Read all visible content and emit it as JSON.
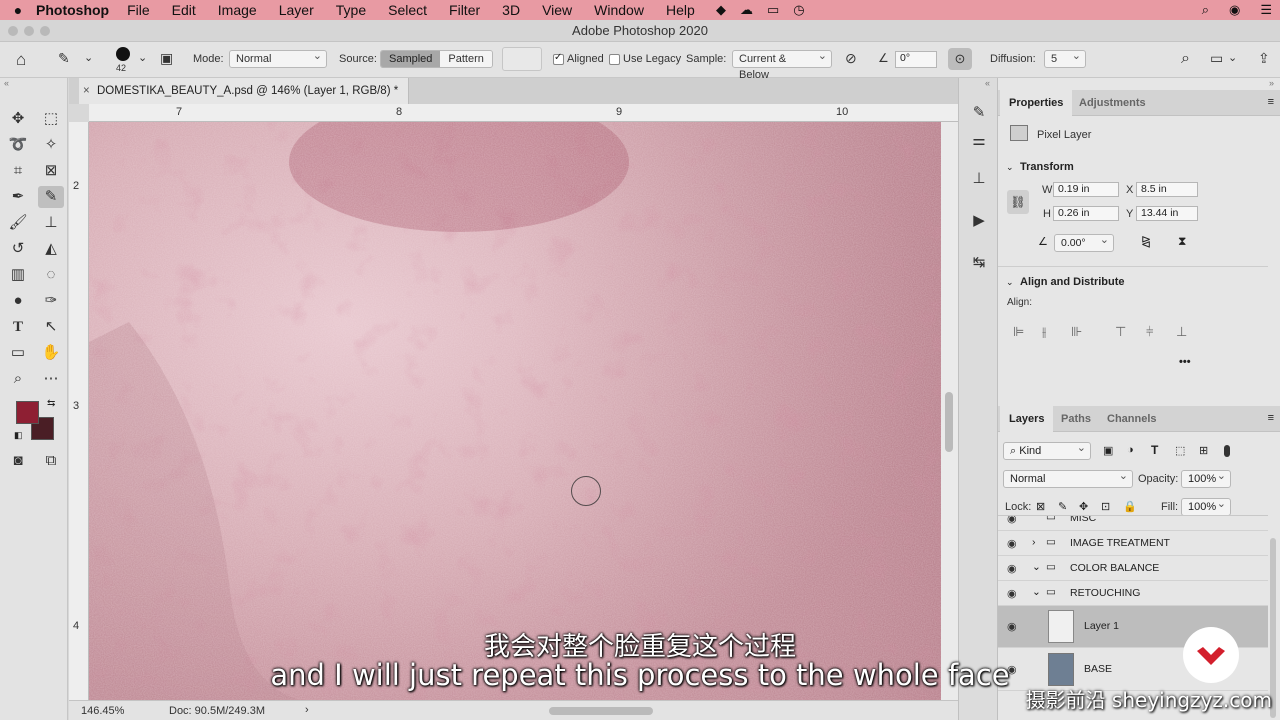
{
  "menubar": {
    "app": "Photoshop",
    "items": [
      "File",
      "Edit",
      "Image",
      "Layer",
      "Type",
      "Select",
      "Filter",
      "3D",
      "View",
      "Window",
      "Help"
    ]
  },
  "window": {
    "title": "Adobe Photoshop 2020"
  },
  "options": {
    "brush_size": "42",
    "mode_label": "Mode:",
    "mode_value": "Normal",
    "source_label": "Source:",
    "source_sampled": "Sampled",
    "source_pattern": "Pattern",
    "aligned_label": "Aligned",
    "use_legacy_label": "Use Legacy",
    "sample_label": "Sample:",
    "sample_value": "Current & Below",
    "angle_value": "0°",
    "diffusion_label": "Diffusion:",
    "diffusion_value": "5"
  },
  "document": {
    "tab_title": "DOMESTIKA_BEAUTY_A.psd @ 146% (Layer 1, RGB/8) *",
    "ruler_top": [
      "7",
      "8",
      "9",
      "10"
    ],
    "ruler_left": [
      "2",
      "3",
      "4"
    ],
    "zoom": "146.45%",
    "doc_size": "Doc: 90.5M/249.3M"
  },
  "colors": {
    "foreground": "#8e1f33",
    "background": "#4a1e25",
    "menubar": "#e89aa3"
  },
  "properties": {
    "tabs": [
      "Properties",
      "Adjustments"
    ],
    "layer_type": "Pixel Layer",
    "transform_title": "Transform",
    "w_label": "W",
    "w_value": "0.19 in",
    "x_label": "X",
    "x_value": "8.5 in",
    "h_label": "H",
    "h_value": "0.26 in",
    "y_label": "Y",
    "y_value": "13.44 in",
    "angle_value": "0.00°",
    "align_title": "Align and Distribute",
    "align_label": "Align:",
    "more": "•••"
  },
  "layers": {
    "tabs": [
      "Layers",
      "Paths",
      "Channels"
    ],
    "kind_value": "Kind",
    "blend_value": "Normal",
    "opacity_label": "Opacity:",
    "opacity_value": "100%",
    "lock_label": "Lock:",
    "fill_label": "Fill:",
    "fill_value": "100%",
    "rows": [
      {
        "name": "MISC"
      },
      {
        "name": "IMAGE TREATMENT"
      },
      {
        "name": "COLOR BALANCE"
      },
      {
        "name": "RETOUCHING"
      },
      {
        "name": "Layer 1"
      },
      {
        "name": "BASE"
      }
    ]
  },
  "subtitles": {
    "cn": "我会对整个脸重复这个过程",
    "en": "and I will just repeat this process to the whole face"
  },
  "watermark": "摄影前沿 sheyingzyz.com"
}
